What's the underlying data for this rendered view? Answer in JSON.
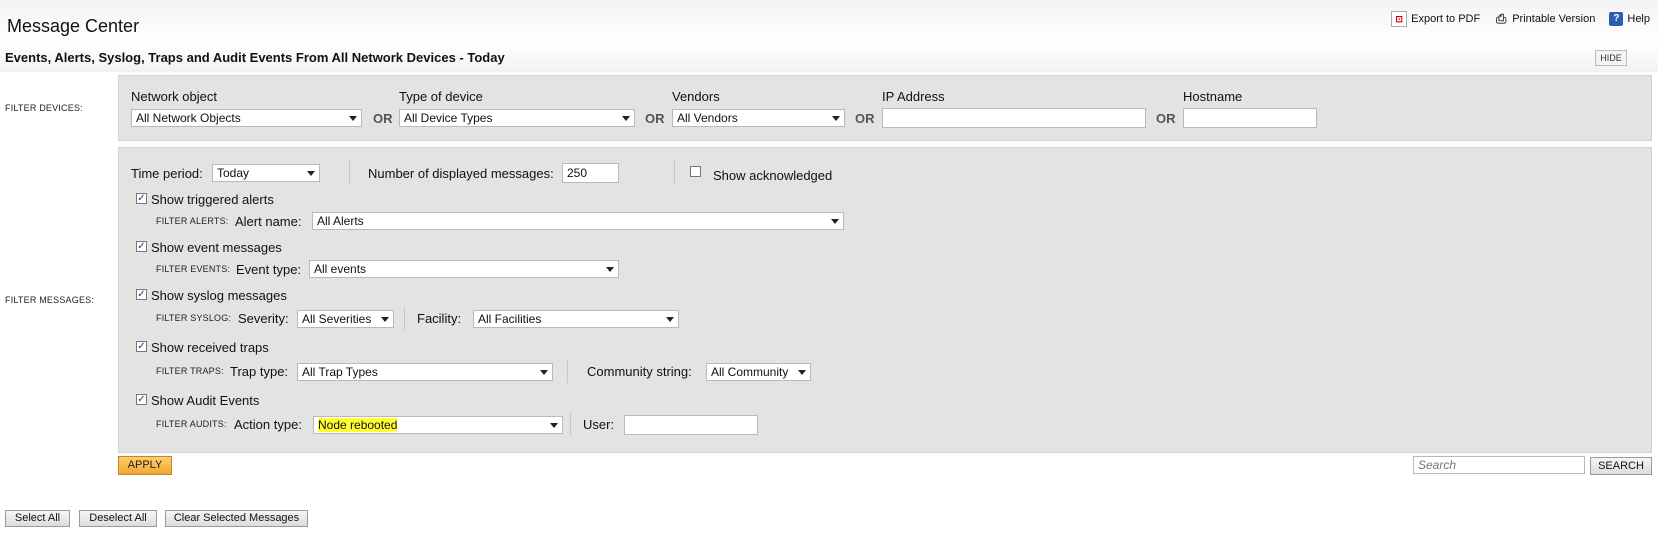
{
  "header": {
    "title": "Message Center",
    "subtitle": "Events, Alerts, Syslog, Traps and Audit Events From All Network Devices - Today",
    "export_pdf": "Export to PDF",
    "printable": "Printable Version",
    "help": "Help",
    "hide": "HIDE"
  },
  "filter_devices": {
    "label": "FILTER DEVICES:",
    "or": "OR",
    "network_object": {
      "label": "Network object",
      "value": "All Network Objects"
    },
    "device_type": {
      "label": "Type of device",
      "value": "All Device Types"
    },
    "vendors": {
      "label": "Vendors",
      "value": "All Vendors"
    },
    "ip_address": {
      "label": "IP Address",
      "value": ""
    },
    "hostname": {
      "label": "Hostname",
      "value": ""
    }
  },
  "filter_messages": {
    "label": "FILTER MESSAGES:",
    "time_period": {
      "label": "Time period:",
      "value": "Today"
    },
    "num_messages": {
      "label": "Number of displayed messages:",
      "value": "250"
    },
    "show_acknowledged": {
      "label": "Show acknowledged",
      "checked": false
    },
    "alerts": {
      "show_label": "Show triggered alerts",
      "checked": true,
      "filter_label": "FILTER ALERTS:",
      "field_label": "Alert name:",
      "value": "All Alerts"
    },
    "events": {
      "show_label": "Show event messages",
      "checked": true,
      "filter_label": "FILTER EVENTS:",
      "field_label": "Event type:",
      "value": "All events"
    },
    "syslog": {
      "show_label": "Show syslog messages",
      "checked": true,
      "filter_label": "FILTER SYSLOG:",
      "severity_label": "Severity:",
      "severity_value": "All Severities",
      "facility_label": "Facility:",
      "facility_value": "All Facilities"
    },
    "traps": {
      "show_label": "Show received traps",
      "checked": true,
      "filter_label": "FILTER TRAPS:",
      "trap_label": "Trap type:",
      "trap_value": "All Trap Types",
      "community_label": "Community string:",
      "community_value": "All Community"
    },
    "audits": {
      "show_label": "Show Audit Events",
      "checked": true,
      "filter_label": "FILTER AUDITS:",
      "action_label": "Action type:",
      "action_value": "Node rebooted",
      "user_label": "User:",
      "user_value": ""
    }
  },
  "actions": {
    "apply": "APPLY",
    "search_placeholder": "Search",
    "search_button": "SEARCH",
    "select_all": "Select All",
    "deselect_all": "Deselect All",
    "clear_selected": "Clear Selected Messages"
  },
  "colors": {
    "highlight": "#ffff33",
    "apply_button": "#f0a830",
    "help_icon": "#2a5fb0",
    "panel_bg": "#e3e3e3"
  }
}
